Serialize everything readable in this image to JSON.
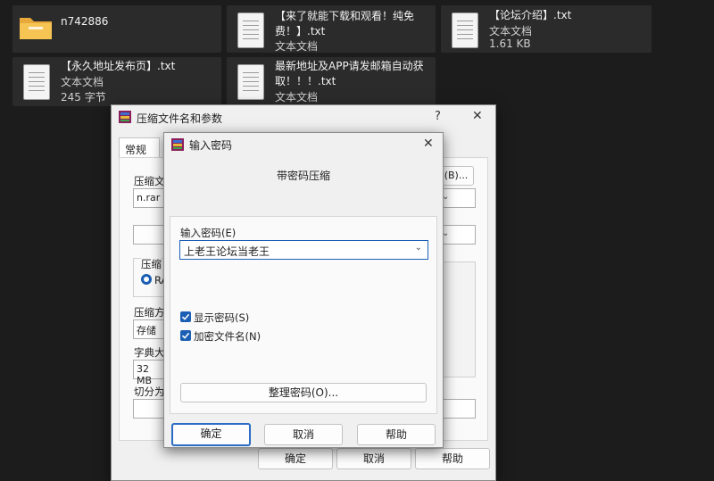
{
  "desktop": {
    "files": [
      {
        "name": "n742886"
      },
      {
        "name": "【来了就能下载和观看！纯免费！】.txt",
        "type": "文本文档"
      },
      {
        "name": "【论坛介绍】.txt",
        "type": "文本文档",
        "size": "1.61 KB"
      },
      {
        "name": "【永久地址发布页】.txt",
        "type": "文本文档",
        "size": "245 字节"
      },
      {
        "name": "最新地址及APP请发邮箱自动获取！！！.txt",
        "type": "文本文档"
      }
    ]
  },
  "back_dialog": {
    "title": "压缩文件名和参数",
    "help_glyph": "?",
    "close_glyph": "✕",
    "tab_general": "常规",
    "filename_label": "压缩文",
    "filename_value": "n.rar",
    "browse_label": "(B)...",
    "format_label": "压缩",
    "format_option": "RA",
    "method_label": "压缩方",
    "method_value": "存储",
    "dict_label": "字典大",
    "dict_value": "32 MB",
    "split_label": "切分为",
    "ok": "确定",
    "cancel": "取消",
    "help": "帮助"
  },
  "pw_dialog": {
    "title": "输入密码",
    "close_glyph": "✕",
    "heading": "带密码压缩",
    "enter_label": "输入密码(E)",
    "password_value": "上老王论坛当老王",
    "show_password": "显示密码(S)",
    "encrypt_names": "加密文件名(N)",
    "show_checked": true,
    "encrypt_checked": true,
    "organize_btn": "整理密码(O)...",
    "ok": "确定",
    "cancel": "取消",
    "help": "帮助"
  }
}
